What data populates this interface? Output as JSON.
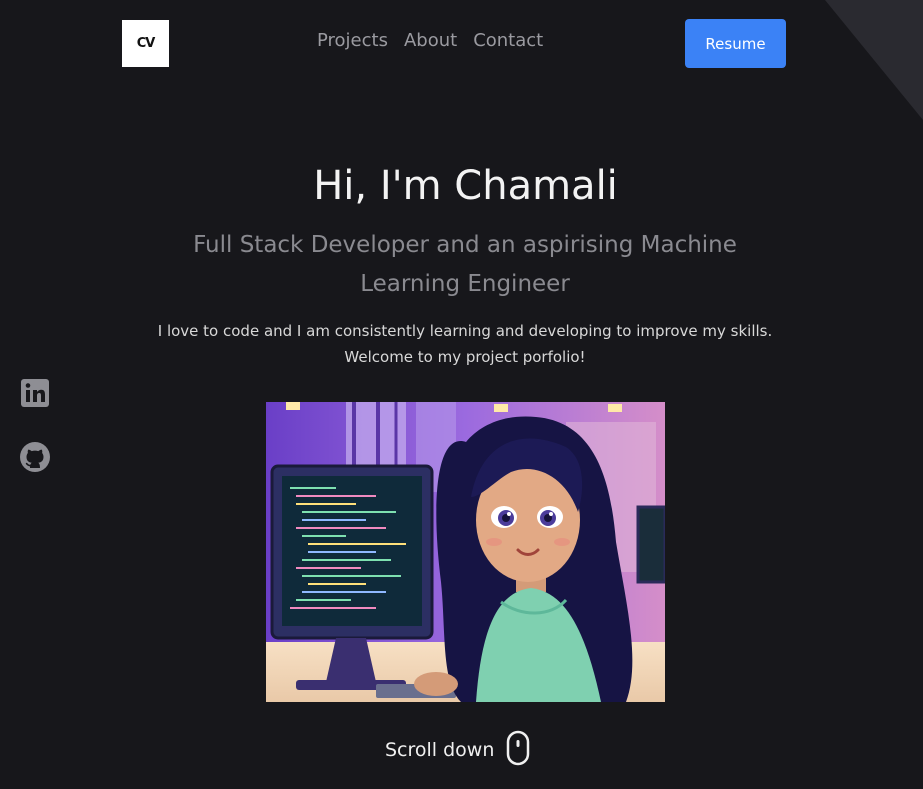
{
  "header": {
    "logo_text": "CV",
    "nav": [
      "Projects",
      "About",
      "Contact"
    ],
    "resume_label": "Resume"
  },
  "hero": {
    "title": "Hi, I'm Chamali",
    "subtitle": "Full Stack Developer and an aspirising Machine Learning Engineer",
    "description": "I love to code and I am consistently learning and developing to improve my skills. Welcome to my project porfolio!"
  },
  "social": {
    "icons": [
      "linkedin-icon",
      "github-icon"
    ]
  },
  "scroll": {
    "label": "Scroll down",
    "icon": "mouse-icon"
  },
  "colors": {
    "background": "#17171b",
    "accent": "#3b82f6",
    "muted_text": "#8a8a90"
  }
}
